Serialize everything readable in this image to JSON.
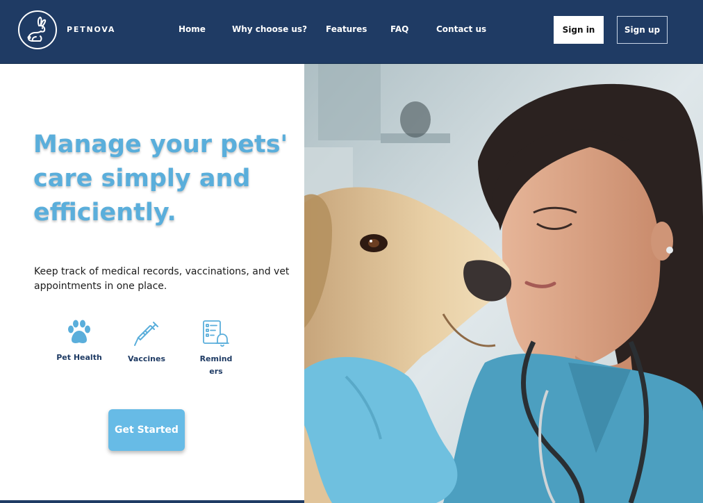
{
  "brand": {
    "name": "PETNOVA",
    "logo_icon": "rabbit-icon"
  },
  "nav": {
    "items": [
      "Home",
      "Why choose us?",
      "Features",
      "FAQ",
      "Contact us"
    ]
  },
  "auth": {
    "sign_in": "Sign in",
    "sign_up": "Sign up"
  },
  "hero": {
    "headline": "Manage your pets' care simply and efficiently.",
    "subtitle": "Keep track of medical records, vaccinations, and vet appointments in one place.",
    "features": [
      {
        "icon": "paw-icon",
        "label": "Pet Health"
      },
      {
        "icon": "syringe-icon",
        "label": "Vaccines"
      },
      {
        "icon": "reminder-checklist-icon",
        "label": "Remind ers"
      }
    ],
    "cta": "Get Started"
  },
  "image": {
    "subject": "vet-with-dog-photo"
  },
  "colors": {
    "header_bg": "#1f3b64",
    "accent": "#5aaedb",
    "cta_bg": "#67bbe6",
    "text_dark": "#1b1b1b"
  }
}
